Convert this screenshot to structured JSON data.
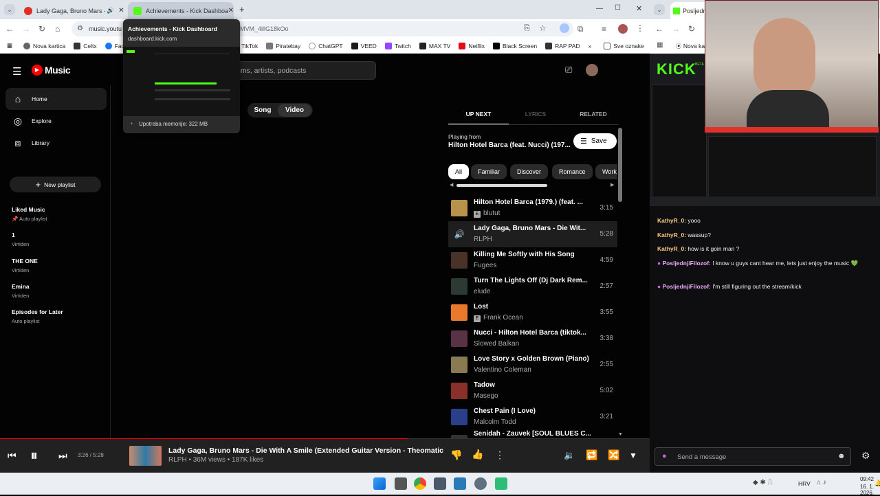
{
  "browser": {
    "tabs": [
      {
        "title": "Lady Gaga, Bruno Mars - Die..."
      },
      {
        "title": "Achievements - Kick Dashboard"
      }
    ],
    "new_tab": "+",
    "url": "music.youtu",
    "url_tail": "MVM_4illG18kOo",
    "bookmarks": [
      "Nova kartica",
      "Celtx",
      "Fac",
      "TikTok",
      "Piratebay",
      "ChatGPT",
      "VEED",
      "Twitch",
      "MAX TV",
      "Netflix",
      "Black Screen",
      "RAP PAD"
    ],
    "bookmarks_more": "»",
    "bookmarks_other": "Sve oznake",
    "tooltip": {
      "title": "Achievements - Kick Dashboard",
      "domain": "dashboard.kick.com",
      "memory": "Upotreba memorije: 322 MB"
    }
  },
  "ytm": {
    "logo": "Music",
    "search_placeholder": "ums, artists, podcasts",
    "nav": [
      {
        "label": "Home",
        "icon": "home-icon"
      },
      {
        "label": "Explore",
        "icon": "compass-icon"
      },
      {
        "label": "Library",
        "icon": "library-icon"
      }
    ],
    "new_playlist": "New playlist",
    "playlists": [
      {
        "title": "Liked Music",
        "subtitle": "Auto playlist"
      },
      {
        "title": "1",
        "subtitle": "Virtiden"
      },
      {
        "title": "THE ONE",
        "subtitle": "Virtiden"
      },
      {
        "title": "Emina",
        "subtitle": "Virtiden"
      },
      {
        "title": "Episodes for Later",
        "subtitle": "Auto playlist"
      }
    ],
    "toggle": {
      "song": "Song",
      "video": "Video"
    },
    "tabs": {
      "up_next": "UP NEXT",
      "lyrics": "LYRICS",
      "related": "RELATED"
    },
    "playing_from_label": "Playing from",
    "playing_from": "Hilton Hotel Barca (feat. Nucci) (197...",
    "save": "Save",
    "chips": [
      "All",
      "Familiar",
      "Discover",
      "Romance",
      "Work"
    ],
    "queue": [
      {
        "title": "Hilton Hotel Barca (1979.) (feat. ...",
        "artist": "blutut",
        "explicit": true,
        "duration": "3:15",
        "color": "#b8914a"
      },
      {
        "title": "Lady Gaga, Bruno Mars - Die Wit...",
        "artist": "RLPH",
        "explicit": false,
        "duration": "5:28",
        "color": "#333333",
        "playing": true
      },
      {
        "title": "Killing Me Softly with His Song",
        "artist": "Fugees",
        "explicit": false,
        "duration": "4:59",
        "color": "#4a3326"
      },
      {
        "title": "Turn The Lights Off (Dj Dark Rem...",
        "artist": "elude",
        "explicit": false,
        "duration": "2:57",
        "color": "#2c3a33"
      },
      {
        "title": "Lost",
        "artist": "Frank Ocean",
        "explicit": true,
        "duration": "3:55",
        "color": "#e8782c"
      },
      {
        "title": "Nucci - Hilton Hotel Barca (tiktok...",
        "artist": "Slowed Balkan",
        "explicit": false,
        "duration": "3:38",
        "color": "#5a3246"
      },
      {
        "title": "Love Story x Golden Brown (Piano)",
        "artist": "Valentino Coleman",
        "explicit": false,
        "duration": "2:55",
        "color": "#8a7a52"
      },
      {
        "title": "Tadow",
        "artist": "Masego",
        "explicit": false,
        "duration": "5:02",
        "color": "#8a2f2a"
      },
      {
        "title": "Chest Pain (I Love)",
        "artist": "Malcolm Todd",
        "explicit": false,
        "duration": "3:21",
        "color": "#2a3f8a"
      },
      {
        "title": "Senidah - Zauvek [SOUL BLUES C...",
        "artist": "",
        "explicit": false,
        "duration": "",
        "color": "#333333"
      }
    ],
    "player": {
      "time": "3:26 / 5:28",
      "progress": 0.628,
      "title": "Lady Gaga, Bruno Mars - Die With A Smile (Extended Guitar Version - Theomatica ...",
      "meta": "RLPH • 36M views • 187K likes"
    }
  },
  "kick": {
    "logo": "KICK",
    "logo_badge": "BETA",
    "chat": [
      {
        "user": "KathyR_0:",
        "msg": " yooo",
        "color": "#f5c77e"
      },
      {
        "user": "KathyR_0:",
        "msg": " wassup?",
        "color": "#f5c77e"
      },
      {
        "user": "KathyR_0:",
        "msg": " how is it goin man ?",
        "color": "#f5c77e"
      },
      {
        "user": "PosljednjiFilozof:",
        "msg": " I know u guys cant hear me, lets just enjoy the music 💚",
        "color": "#e9a8f5",
        "badge": true
      },
      {
        "user": "PosljednjiFilozof:",
        "msg": " I'm still figuring out the stream/kick",
        "color": "#e9a8f5",
        "badge": true
      }
    ],
    "send_placeholder": "Send a message",
    "right_tab_title": "Posljednj"
  },
  "taskbar": {
    "lang": "HRV",
    "time": "09:42",
    "date": "16. 1. 2026."
  }
}
